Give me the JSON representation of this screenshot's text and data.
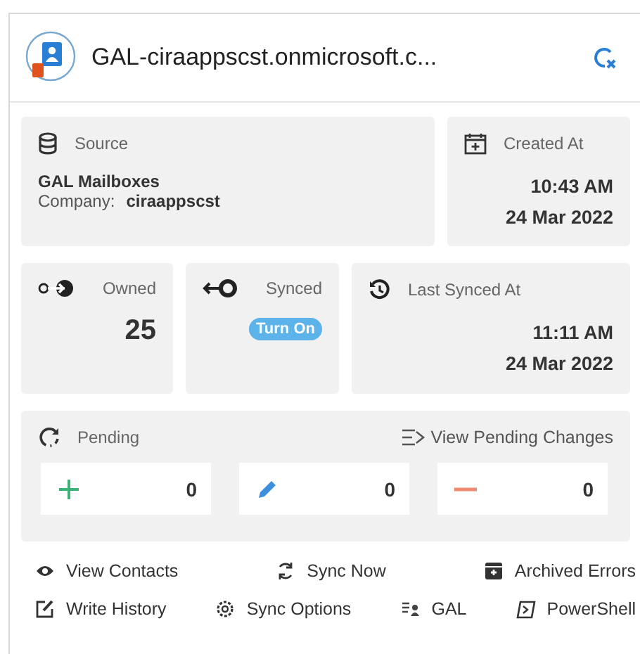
{
  "header": {
    "title": "GAL-ciraappscst.onmicrosoft.c..."
  },
  "source": {
    "label": "Source",
    "name": "GAL Mailboxes",
    "company_label": "Company:",
    "company": "ciraappscst"
  },
  "created": {
    "label": "Created At",
    "time": "10:43 AM",
    "date": "24 Mar 2022"
  },
  "owned": {
    "label": "Owned",
    "value": "25"
  },
  "synced": {
    "label": "Synced",
    "button": "Turn On"
  },
  "last_synced": {
    "label": "Last Synced At",
    "time": "11:11 AM",
    "date": "24 Mar 2022"
  },
  "pending": {
    "label": "Pending",
    "link": "View Pending Changes",
    "counts": [
      {
        "kind": "add",
        "value": "0"
      },
      {
        "kind": "edit",
        "value": "0"
      },
      {
        "kind": "remove",
        "value": "0"
      }
    ]
  },
  "actions": [
    [
      {
        "kind": "eye",
        "label": "View Contacts"
      },
      {
        "kind": "sync",
        "label": "Sync Now"
      },
      {
        "kind": "archive",
        "label": "Archived Errors"
      }
    ],
    [
      {
        "kind": "write",
        "label": "Write History"
      },
      {
        "kind": "gear",
        "label": "Sync Options"
      },
      {
        "kind": "gal",
        "label": "GAL"
      },
      {
        "kind": "shell",
        "label": "PowerShell"
      }
    ]
  ]
}
